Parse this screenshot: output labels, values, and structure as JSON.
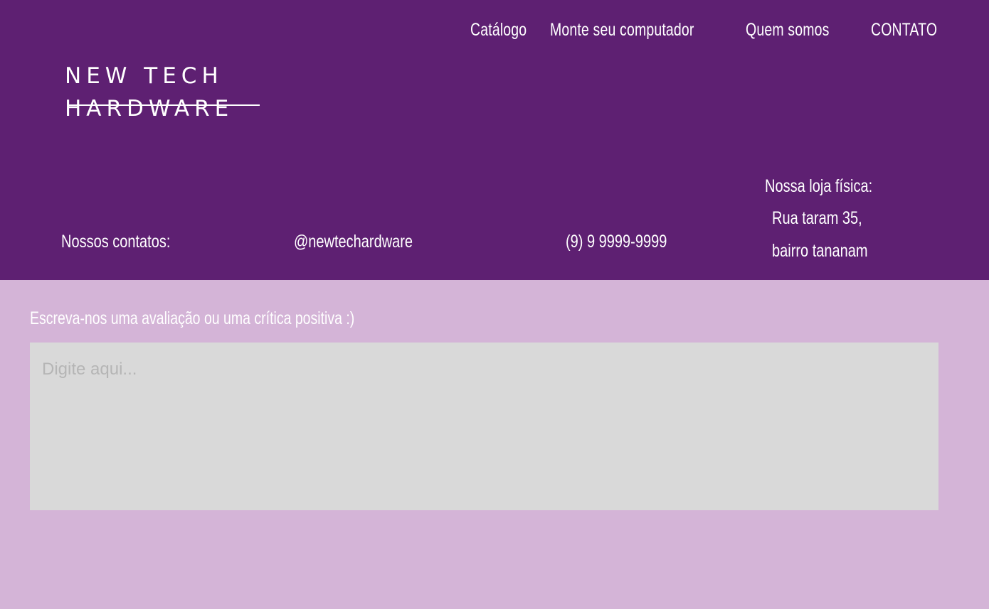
{
  "nav": {
    "catalog": "Catálogo",
    "build": "Monte seu computador",
    "about": "Quem somos",
    "contact": "CONTATO"
  },
  "logo": {
    "line1": "NEW TECH",
    "line2": "HARDWARE"
  },
  "contacts": {
    "heading": "Nossos contatos:",
    "instagram": "@newtechardware",
    "phone": "(9) 9 9999-9999",
    "store_heading": "Nossa loja física:",
    "store_line1": "Rua taram 35,",
    "store_line2": "bairro tananam"
  },
  "review": {
    "label": "Escreva-nos uma avaliação ou uma crítica positiva :)",
    "placeholder": "Digite aqui...",
    "value": ""
  },
  "colors": {
    "header_bg": "#5e2072",
    "page_bg": "#d4b4d7",
    "textarea_bg": "#d9d9d9",
    "text": "#ffffff"
  }
}
